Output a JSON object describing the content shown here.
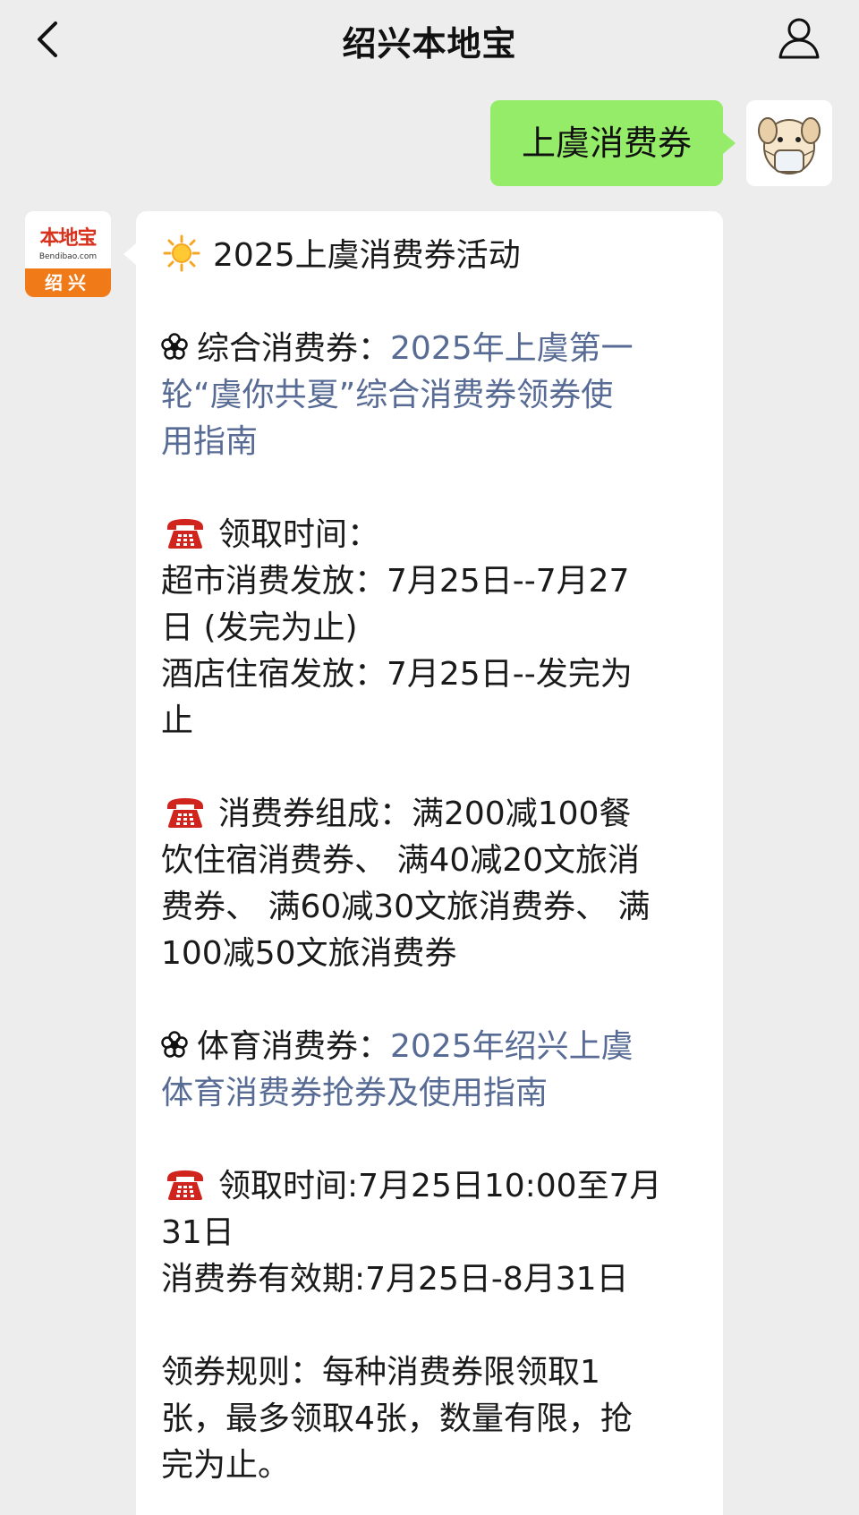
{
  "header": {
    "title": "绍兴本地宝",
    "back_icon": "chevron-left-icon",
    "profile_icon": "person-icon"
  },
  "outgoing": {
    "text": "上虞消费券",
    "avatar_icon": "dog-mask-avatar-icon",
    "bubble_color": "#95ec69"
  },
  "bot": {
    "logo_main": "本地宝",
    "logo_sub": "Bendibao.com",
    "logo_city": "绍兴",
    "brand_color": "#f07a18"
  },
  "message": {
    "heading": "2025上虞消费券活动",
    "section1": {
      "label": "综合消费券：",
      "link_lines": [
        "2025年上虞第一",
        "轮“虞你共夏”综合消费券领券使",
        "用指南"
      ]
    },
    "time1": {
      "label": "领取时间：",
      "lines": [
        "超市消费发放：7月25日--7月27",
        "日 (发完为止)",
        "酒店住宿发放：7月25日--发完为",
        "止"
      ]
    },
    "composition": {
      "label": "消费券组成：满200减100餐",
      "lines": [
        "饮住宿消费券、 满40减20文旅消",
        "费券、 满60减30文旅消费券、 满",
        "100减50文旅消费券"
      ]
    },
    "section2": {
      "label": "体育消费券：",
      "link_lines": [
        "2025年绍兴上虞",
        "体育消费券抢券及使用指南"
      ]
    },
    "time2": {
      "label": "领取时间:7月25日10:00至7月",
      "lines": [
        "31日",
        "消费券有效期:7月25日-8月31日"
      ]
    },
    "rules": {
      "lines": [
        "领券规则：每种消费券限领取1",
        "张，最多领取4张，数量有限，抢",
        "完为止。"
      ]
    },
    "link_color": "#576b95"
  }
}
